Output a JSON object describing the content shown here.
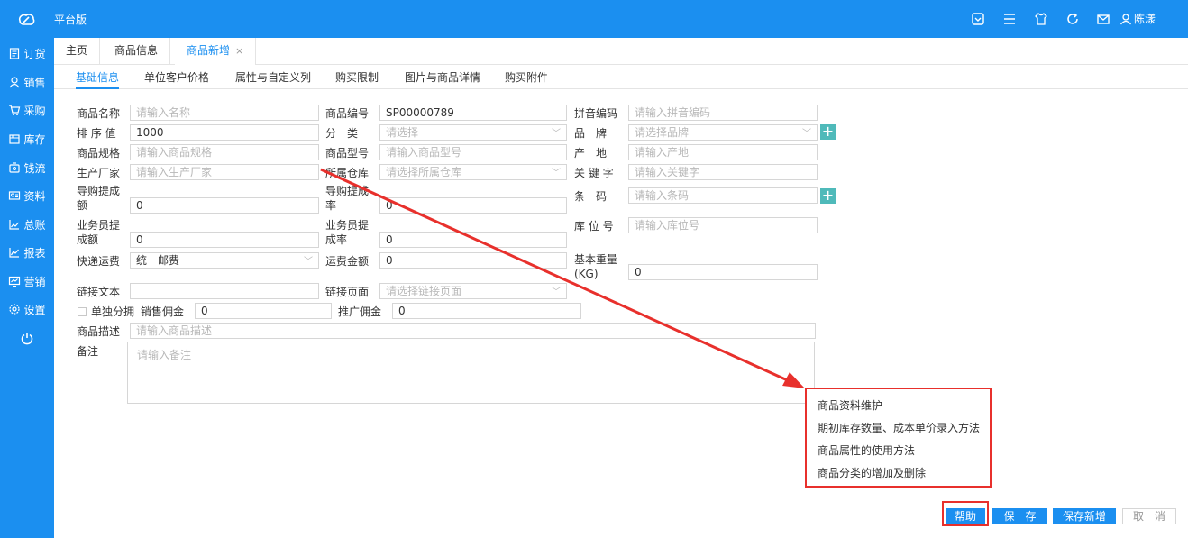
{
  "app": {
    "title": "平台版",
    "user": "陈漾"
  },
  "topbar_icons": [
    "app-icon",
    "menu-icon",
    "shirt-icon",
    "refresh-icon",
    "mail-icon",
    "user-icon"
  ],
  "sidebar": {
    "items": [
      {
        "label": "订货",
        "icon": "clipboard-icon"
      },
      {
        "label": "销售",
        "icon": "person-icon"
      },
      {
        "label": "采购",
        "icon": "cart-icon"
      },
      {
        "label": "库存",
        "icon": "warehouse-icon"
      },
      {
        "label": "钱流",
        "icon": "money-icon"
      },
      {
        "label": "资料",
        "icon": "profile-icon"
      },
      {
        "label": "总账",
        "icon": "chart-icon"
      },
      {
        "label": "报表",
        "icon": "report-icon"
      },
      {
        "label": "营销",
        "icon": "marketing-icon"
      },
      {
        "label": "设置",
        "icon": "gear-icon"
      }
    ],
    "power_icon": "power-icon"
  },
  "tabs": [
    {
      "label": "主页"
    },
    {
      "label": "商品信息"
    },
    {
      "label": "商品新增",
      "close": "×"
    }
  ],
  "subtabs": [
    "基础信息",
    "单位客户价格",
    "属性与自定义列",
    "购买限制",
    "图片与商品详情",
    "购买附件"
  ],
  "form": {
    "name_label": "商品名称",
    "name_ph": "请输入名称",
    "code_label": "商品编号",
    "code_value": "SP00000789",
    "pinyin_label": "拼音编码",
    "pinyin_ph": "请输入拼音编码",
    "sort_label": "排 序 值",
    "sort_value": "1000",
    "category_label": "分　类",
    "category_ph": "请选择",
    "brand_label": "品　牌",
    "brand_ph": "请选择品牌",
    "spec_label": "商品规格",
    "spec_ph": "请输入商品规格",
    "model_label": "商品型号",
    "model_ph": "请输入商品型号",
    "origin_label": "产　地",
    "origin_ph": "请输入产地",
    "maker_label": "生产厂家",
    "maker_ph": "请输入生产厂家",
    "warehouse_label": "所属仓库",
    "warehouse_ph": "请选择所属仓库",
    "keyword_label": "关 键 字",
    "keyword_ph": "请输入关键字",
    "guide_amount_label": "导购提成额",
    "guide_amount_value": "0",
    "guide_rate_label": "导购提成率",
    "guide_rate_value": "0",
    "barcode_label": "条　码",
    "barcode_ph": "请输入条码",
    "sales_amount_label": "业务员提成额",
    "sales_amount_value": "0",
    "sales_rate_label": "业务员提成率",
    "sales_rate_value": "0",
    "location_label": "库 位 号",
    "location_ph": "请输入库位号",
    "shipping_label": "快递运费",
    "shipping_value": "统一邮费",
    "freight_label": "运费金额",
    "freight_value": "0",
    "weight_label": "基本重量(KG)",
    "weight_value": "0",
    "link_text_label": "链接文本",
    "link_text_value": "",
    "link_page_label": "链接页面",
    "link_page_ph": "请选择链接页面",
    "separate_label": "单独分拥",
    "sales_comm_label": "销售佣金",
    "sales_comm_value": "0",
    "promo_comm_label": "推广佣金",
    "promo_comm_value": "0",
    "desc_label": "商品描述",
    "desc_ph": "请输入商品描述",
    "remark_label": "备注",
    "remark_ph": "请输入备注"
  },
  "help_menu": {
    "items": [
      "商品资料维护",
      "期初库存数量、成本单价录入方法",
      "商品属性的使用方法",
      "商品分类的增加及删除"
    ]
  },
  "footer": {
    "help": "帮助",
    "save": "保　存",
    "save_new": "保存新增",
    "cancel": "取　消"
  },
  "colors": {
    "primary": "#1b8ff0",
    "annotation": "#e8302c",
    "plus": "#4fbaba"
  }
}
